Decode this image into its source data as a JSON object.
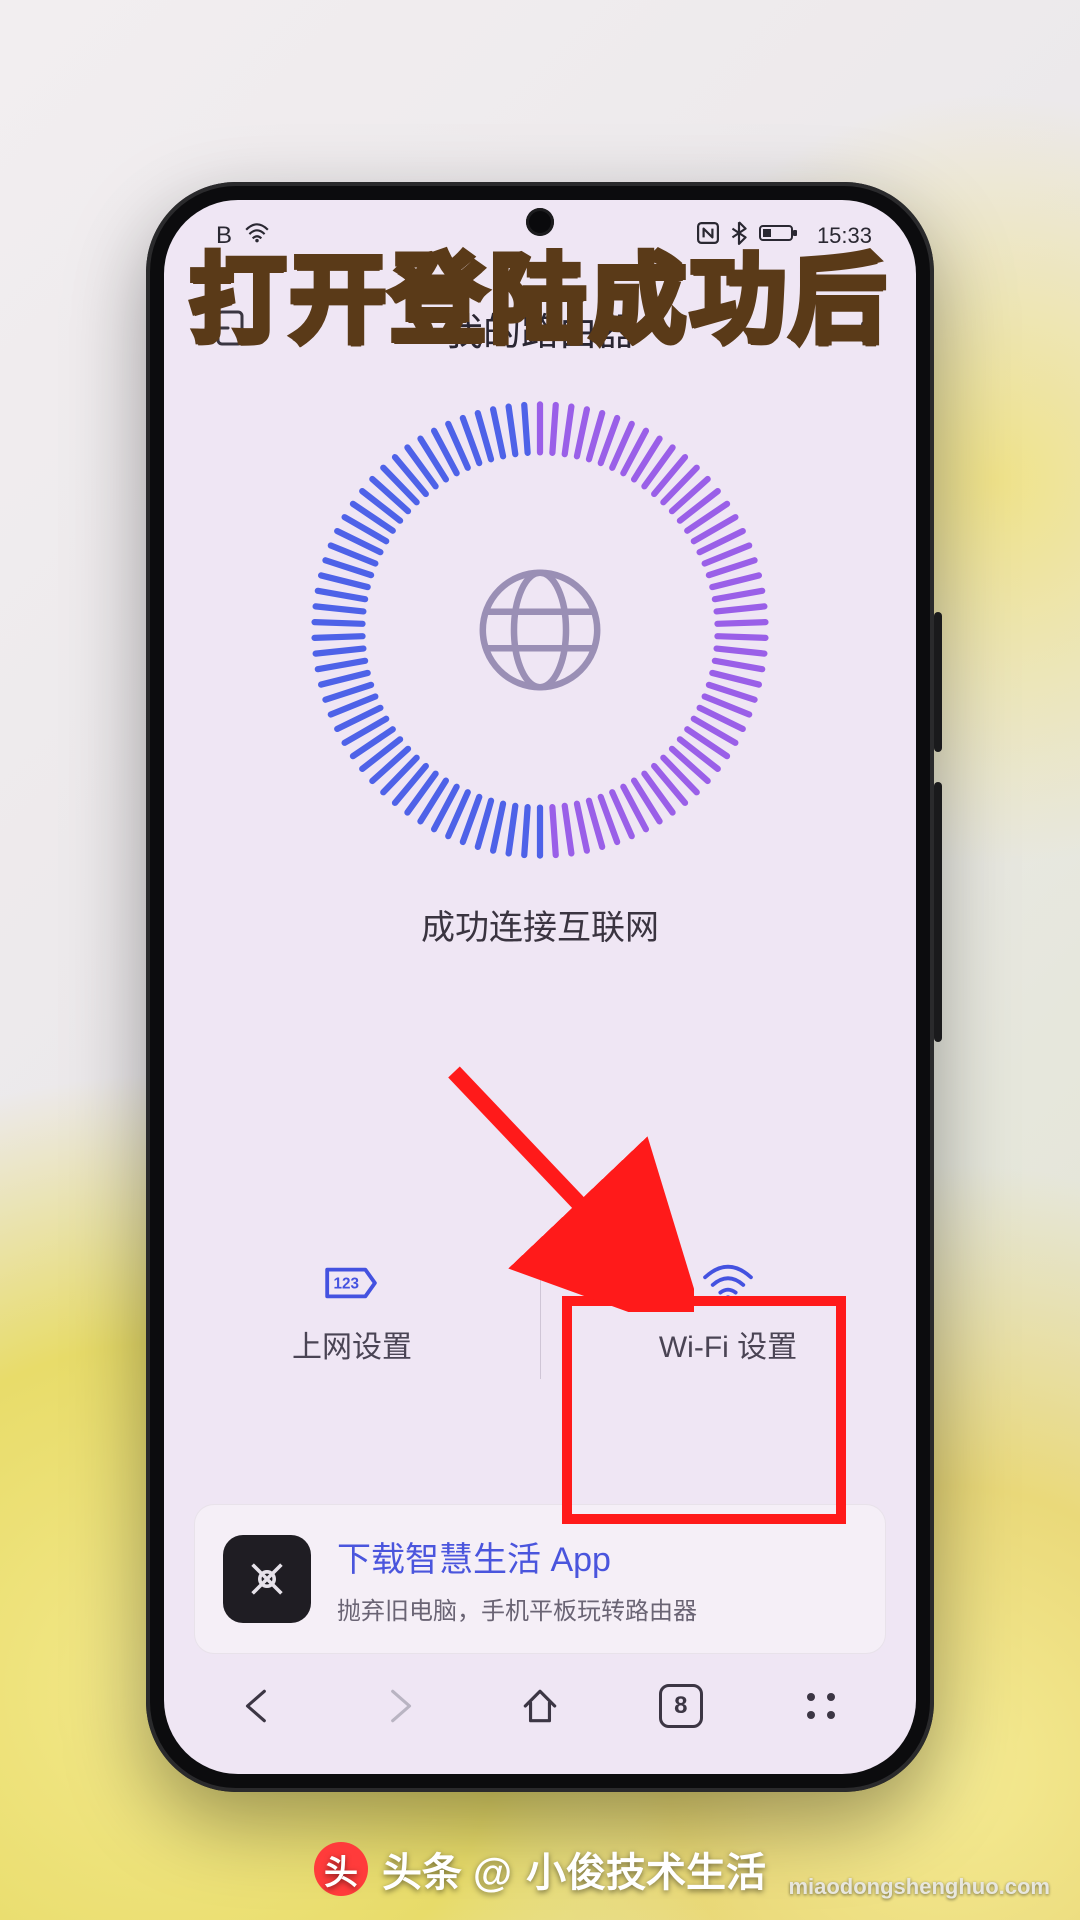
{
  "overlay": {
    "caption": "打开登陆成功后",
    "credit_prefix": "头条 @",
    "credit_name": "小俊技术生活",
    "watermark": "miaodongshenghuo.com"
  },
  "statusbar": {
    "left_icon": "B",
    "time": "15:33"
  },
  "appbar": {
    "title": "我的路由器"
  },
  "main": {
    "connection_status": "成功连接互联网",
    "tiles": [
      {
        "label": "上网设置"
      },
      {
        "label": "Wi-Fi 设置"
      }
    ]
  },
  "promo": {
    "title": "下载智慧生活 App",
    "subtitle": "抛弃旧电脑，手机平板玩转路由器"
  },
  "browser_nav": {
    "tab_count": "8"
  }
}
